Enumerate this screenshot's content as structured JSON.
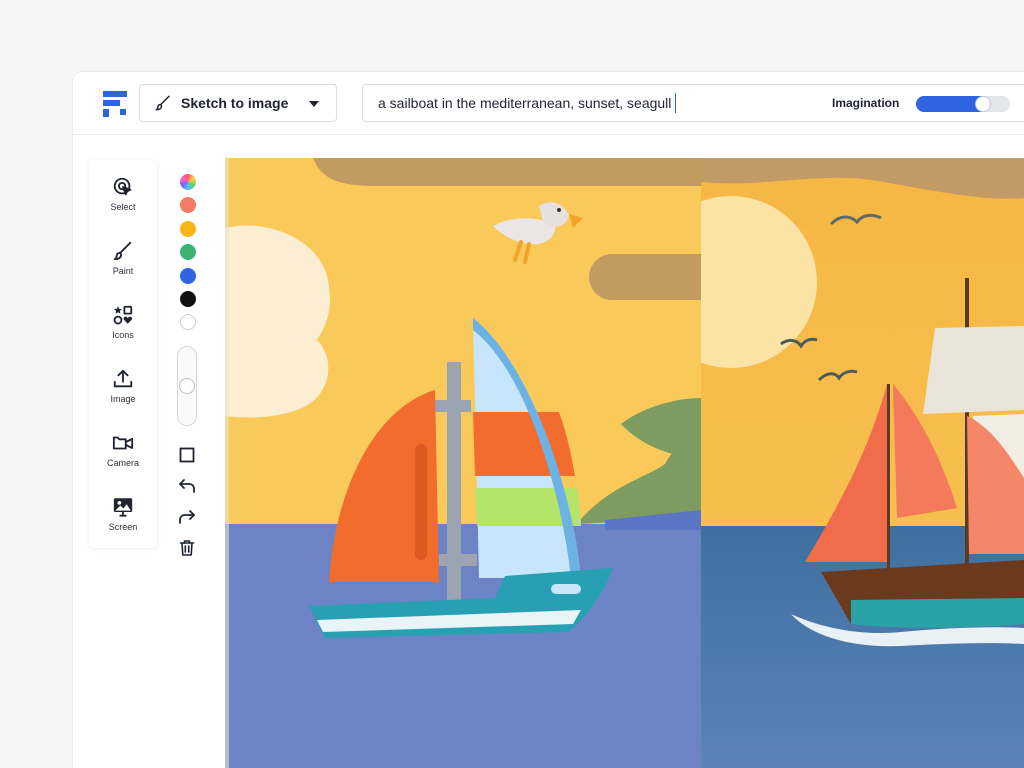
{
  "header": {
    "mode_label": "Sketch to image",
    "prompt_text": "a sailboat in the mediterranean, sunset, seagull",
    "imagination_label": "Imagination",
    "imagination_value": 0.75
  },
  "tools": [
    {
      "label": "Select",
      "icon": "select-cursor-icon"
    },
    {
      "label": "Paint",
      "icon": "paintbrush-icon"
    },
    {
      "label": "Icons",
      "icon": "shapes-icon"
    },
    {
      "label": "Image",
      "icon": "upload-icon"
    },
    {
      "label": "Camera",
      "icon": "camera-icon"
    },
    {
      "label": "Screen",
      "icon": "screen-image-icon"
    }
  ],
  "palette": [
    {
      "name": "rainbow",
      "color": "conic"
    },
    {
      "name": "coral",
      "color": "#f47b63"
    },
    {
      "name": "amber",
      "color": "#f9b515"
    },
    {
      "name": "green",
      "color": "#3db371"
    },
    {
      "name": "blue",
      "color": "#2f64e0"
    },
    {
      "name": "black",
      "color": "#111111"
    },
    {
      "name": "white",
      "color": "#ffffff"
    }
  ],
  "brush_size": 0.5,
  "actions": [
    "square-icon",
    "undo-icon",
    "redo-icon",
    "trash-icon"
  ],
  "colors": {
    "accent": "#2f64e0",
    "sketch_sky": "#f9ca5a",
    "sketch_sea": "#6c83c6",
    "sketch_cloud": "#c39a5f",
    "sketch_hill": "#7e9c60"
  }
}
